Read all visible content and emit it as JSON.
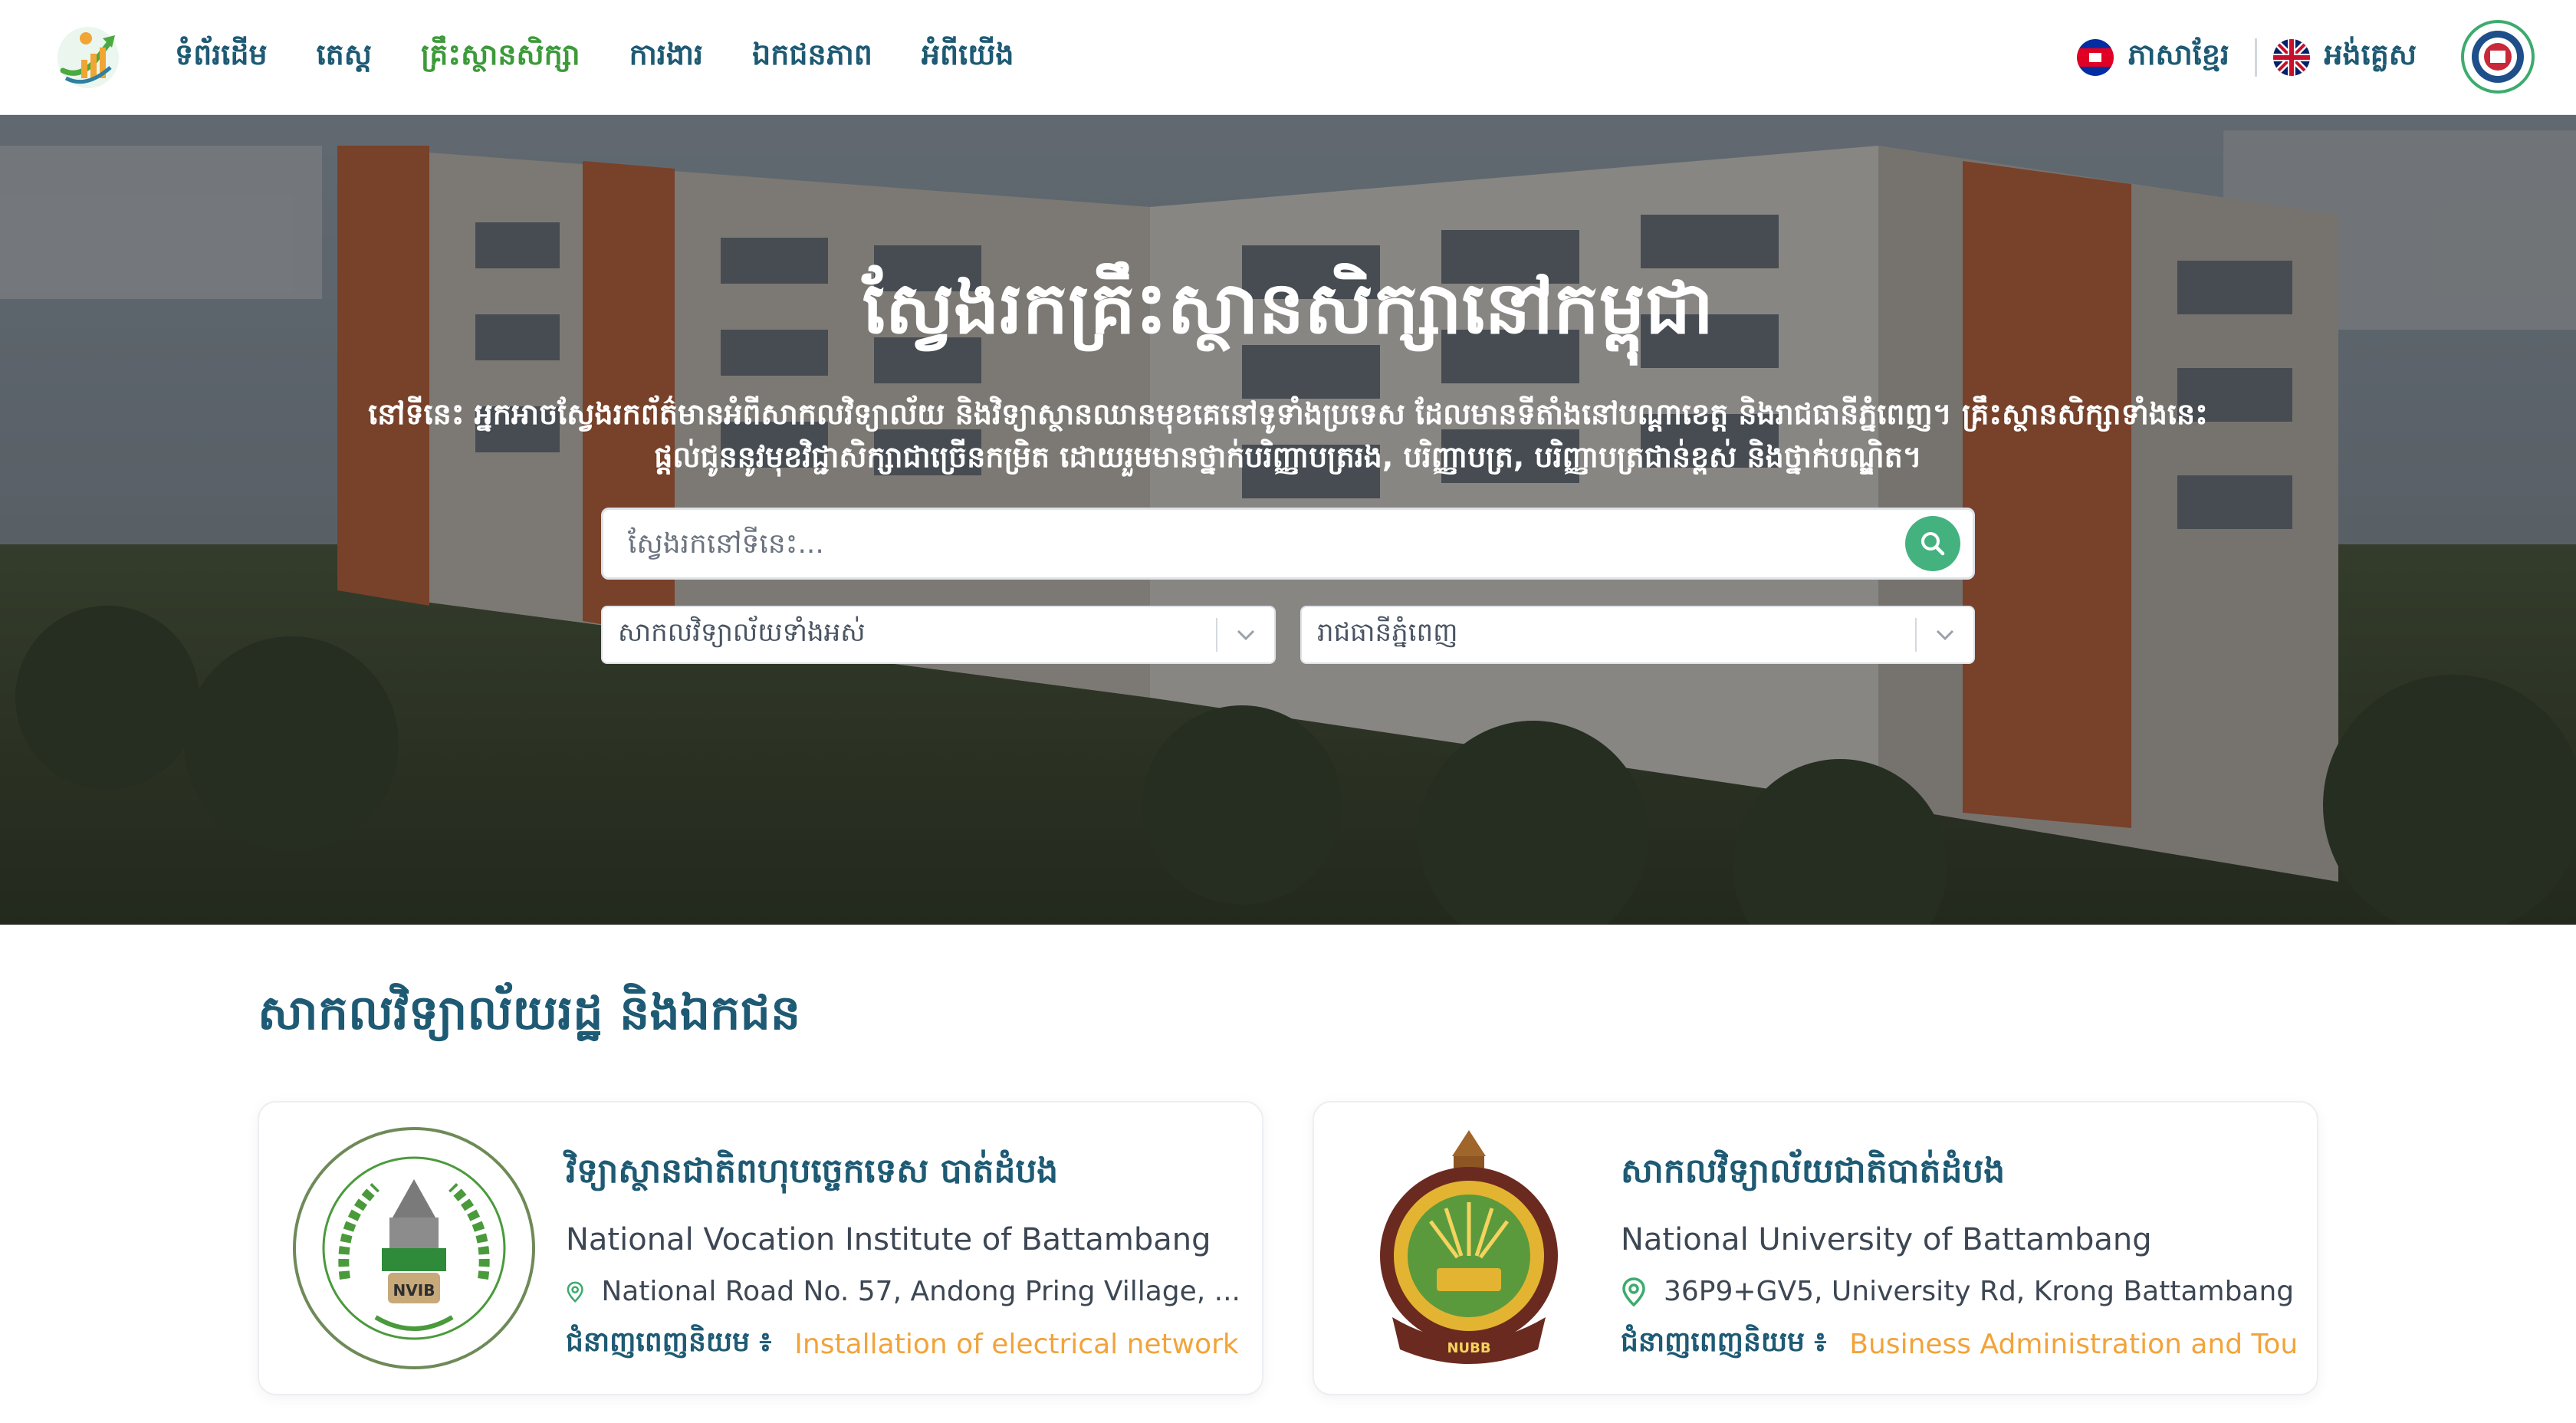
{
  "nav": {
    "items": [
      {
        "label": "ទំព័រដើម",
        "active": false
      },
      {
        "label": "តេស្ត",
        "active": false
      },
      {
        "label": "គ្រឹះស្ថានសិក្សា",
        "active": true
      },
      {
        "label": "ការងារ",
        "active": false
      },
      {
        "label": "ឯកជនភាព",
        "active": false
      },
      {
        "label": "អំពីយើង",
        "active": false
      }
    ],
    "lang_khmer": "ភាសាខ្មែរ",
    "lang_english": "អង់គ្លេស",
    "logo_icon": "growth-chart-logo",
    "avatar_icon": "user-avatar-emblem"
  },
  "hero": {
    "title": "ស្វែងរកគ្រឹះស្ថានសិក្សានៅកម្ពុជា",
    "description": "នៅទីនេះ អ្នកអាចស្វែងរកព័ត៌មានអំពីសាកលវិទ្យាល័យ និងវិទ្យាស្ថានឈានមុខគេនៅទូទាំងប្រទេស ដែលមានទីតាំងនៅបណ្តាខេត្ត និងរាជធានីភ្នំពេញ។ គ្រឹះស្ថានសិក្សាទាំងនេះផ្តល់ជូននូវមុខវិជ្ជាសិក្សាជាច្រើនកម្រិត ដោយរួមមានថ្នាក់បរិញ្ញាបត្ររង, បរិញ្ញាបត្រ, បរិញ្ញាបត្រជាន់ខ្ពស់ និងថ្នាក់បណ្ឌិត។",
    "search_placeholder": "ស្វែងរកនៅទីនេះ...",
    "filter_university": "សាកលវិទ្យាល័យទាំងអស់",
    "filter_province": "រាជធានីភ្នំពេញ"
  },
  "section": {
    "title": "សាកលវិទ្យាល័យរដ្ឋ និងឯកជន"
  },
  "institutions": [
    {
      "name_km": "វិទ្យាស្ថានជាតិពហុបច្ចេកទេស បាត់ដំបង",
      "name_en": "National Vocation Institute of Battambang",
      "address": "National Road No. 57, Andong Pring Village, ...",
      "skill_label": "ជំនាញពេញនិយម ៖",
      "skill_value": "Installation of electrical networks",
      "logo_text": "NVIB"
    },
    {
      "name_km": "សាកលវិទ្យាល័យជាតិបាត់ដំបង",
      "name_en": "National University of Battambang",
      "address": "36P9+GV5, University Rd, Krong Battambang",
      "skill_label": "ជំនាញពេញនិយម ៖",
      "skill_value": "Business Administration and Tour",
      "logo_text": "NUBB"
    }
  ],
  "colors": {
    "primary": "#1e5a74",
    "active_nav": "#3d9a3a",
    "accent_green": "#44b27f",
    "skill_orange": "#f2a33a"
  }
}
